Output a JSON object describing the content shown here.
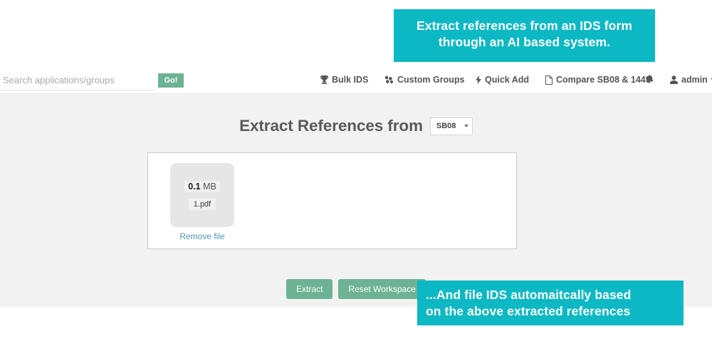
{
  "callouts": {
    "top": {
      "line1": "Extract references from an IDS form",
      "line2": "through an AI based system.",
      "color": "#0bb8c4"
    },
    "bottom": {
      "line1": "...And file IDS automaitcally based",
      "line2": "on the above extracted references",
      "color": "#0bb8c4"
    }
  },
  "navbar": {
    "search": {
      "placeholder": "Search applications/groups",
      "value": ""
    },
    "go_label": "Go!",
    "go_color": "#6cb393",
    "links": [
      {
        "label": "Bulk IDS",
        "icon": "trophy-icon"
      },
      {
        "label": "Custom Groups",
        "icon": "sitemap-icon"
      },
      {
        "label": "Quick Add",
        "icon": "bolt-icon"
      },
      {
        "label": "Compare SB08 & 1449",
        "icon": "file-pdf-icon"
      }
    ],
    "notifications_icon": "bell-icon",
    "user": {
      "icon": "user-icon",
      "label": "admin",
      "caret": "▾"
    }
  },
  "main": {
    "title": "Extract References from",
    "app_select": {
      "value": "SB08",
      "options": [
        "SB08"
      ]
    },
    "file": {
      "size_value": "0.1",
      "size_unit": "MB",
      "name": "1.pdf",
      "remove_label": "Remove file"
    },
    "buttons": [
      {
        "label": "Extract",
        "name": "extract-button"
      },
      {
        "label": "Reset Workspace",
        "name": "reset-workspace-button"
      }
    ]
  }
}
